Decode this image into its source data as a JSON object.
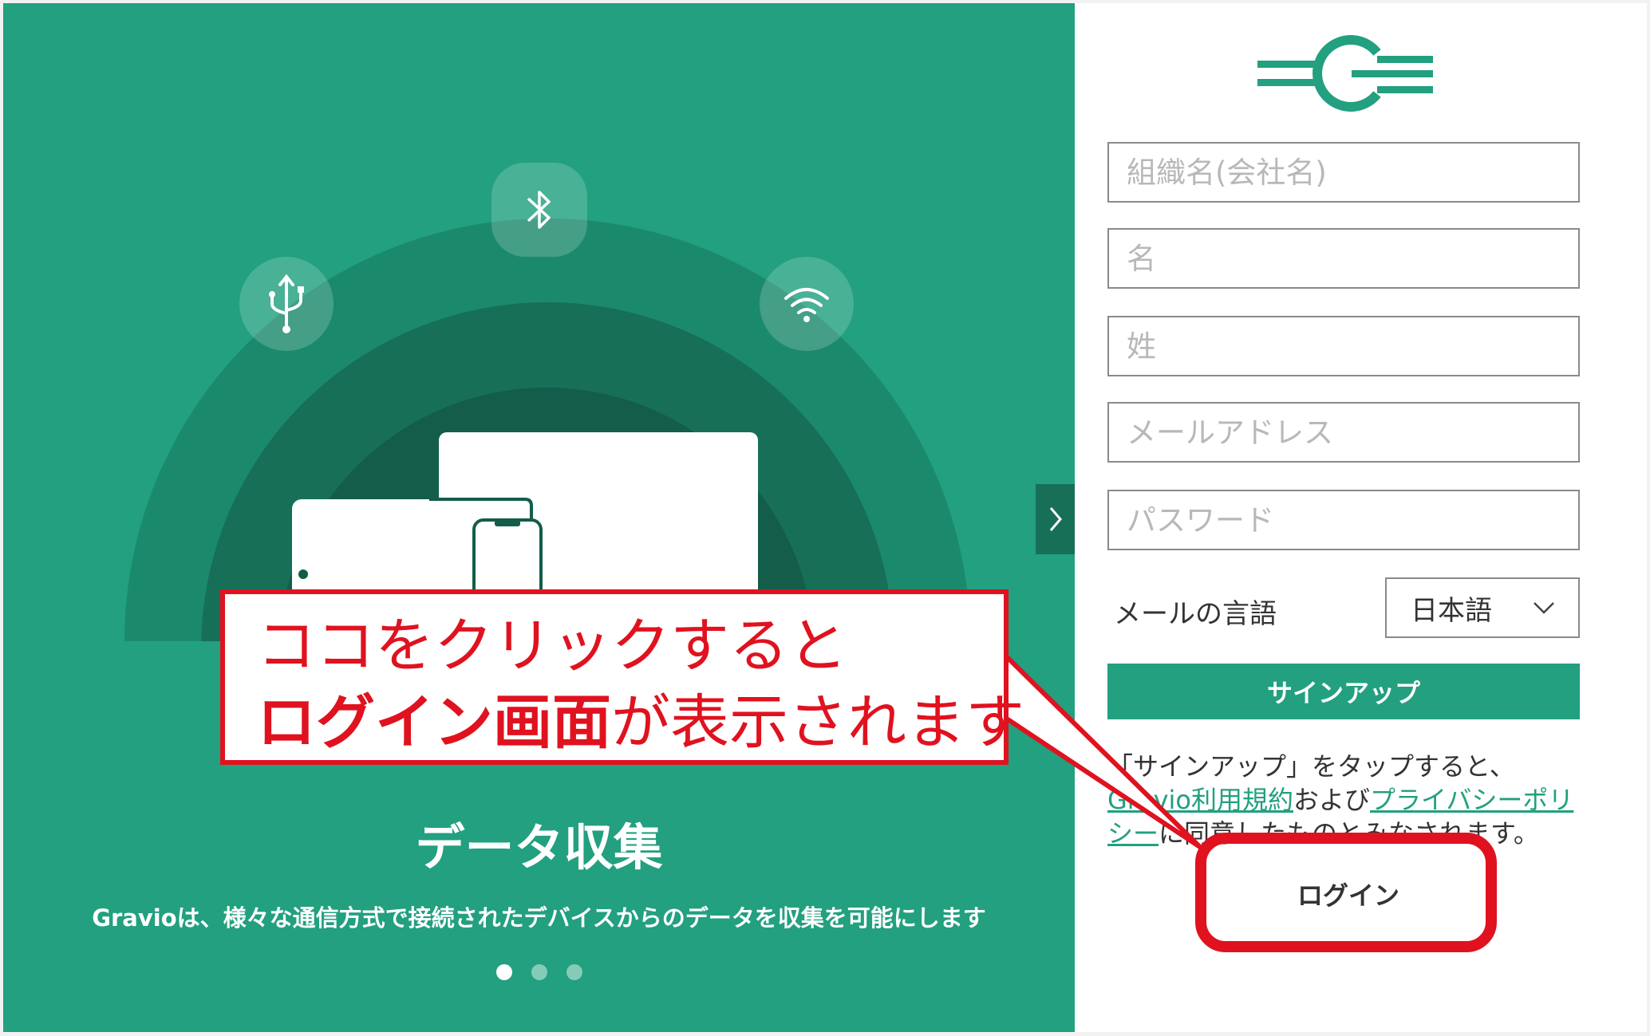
{
  "slide": {
    "title": "データ収集",
    "description": "Gravioは、様々な通信方式で接続されたデバイスからのデータを収集を可能にします",
    "dots": 3,
    "active_dot": 0
  },
  "form": {
    "org_placeholder": "組織名(会社名)",
    "first_name_placeholder": "名",
    "last_name_placeholder": "姓",
    "email_placeholder": "メールアドレス",
    "password_placeholder": "パスワード",
    "language_label": "メールの言語",
    "language_value": "日本語",
    "signup_label": "サインアップ",
    "terms_prefix": "「サインアップ」をタップすると、",
    "terms_link": "Gravio利用規約",
    "terms_middle": "および",
    "privacy_link": "プライバシーポリシー",
    "terms_suffix": "に同意したものとみなされます。",
    "login_label": "ログイン"
  },
  "annotation": {
    "line1": "ココをクリックすると",
    "line2_strong": "ログイン画面",
    "line2_rest": "が表示されます"
  },
  "colors": {
    "brand_green": "#22a07f",
    "annotation_red": "#e0121f"
  }
}
